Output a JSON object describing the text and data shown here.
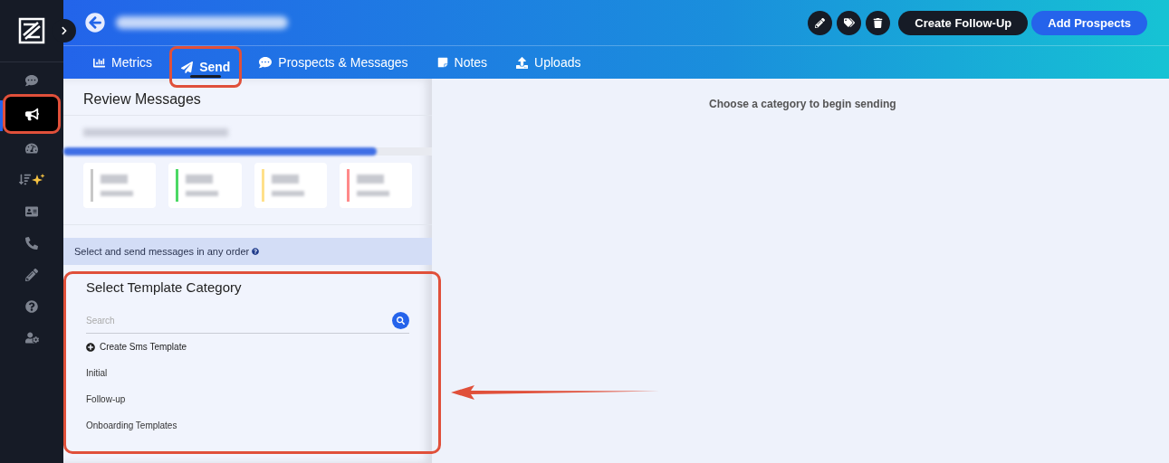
{
  "sidebar": {
    "items": [
      {
        "kind": "chat",
        "selected": false,
        "highlighted": false
      },
      {
        "kind": "megaphone",
        "selected": true,
        "highlighted": true
      },
      {
        "kind": "gauge",
        "selected": false,
        "highlighted": false
      },
      {
        "kind": "sort",
        "selected": false,
        "highlighted": false
      },
      {
        "kind": "contact",
        "selected": false,
        "highlighted": false
      },
      {
        "kind": "phone",
        "selected": false,
        "highlighted": false
      },
      {
        "kind": "pencil",
        "selected": false,
        "highlighted": false
      },
      {
        "kind": "help",
        "selected": false,
        "highlighted": false
      },
      {
        "kind": "user-settings",
        "selected": false,
        "highlighted": false
      }
    ]
  },
  "header": {
    "actions": [
      {
        "kind": "edit"
      },
      {
        "kind": "tags"
      },
      {
        "kind": "delete"
      }
    ],
    "buttons": [
      {
        "label": "Create Follow-Up",
        "kind": "dark"
      },
      {
        "label": "Add Prospects",
        "kind": "primary"
      }
    ]
  },
  "tabs": [
    {
      "label": "Metrics",
      "kind": "chart",
      "selected": false,
      "highlighted": false
    },
    {
      "label": "Send",
      "kind": "send",
      "selected": true,
      "highlighted": true
    },
    {
      "label": "Prospects & Messages",
      "kind": "chat",
      "selected": false,
      "highlighted": false
    },
    {
      "label": "Notes",
      "kind": "note",
      "selected": false,
      "highlighted": false
    },
    {
      "label": "Uploads",
      "kind": "upload",
      "selected": false,
      "highlighted": false
    }
  ],
  "review": {
    "title": "Review Messages",
    "progress": {
      "level": 0.85
    },
    "stats": [
      {
        "color": "#c8c8c8"
      },
      {
        "color": "#4cd964"
      },
      {
        "color": "#ffe08a"
      },
      {
        "color": "#ff8a8a"
      }
    ]
  },
  "notice": "Select and send messages in any order",
  "template_panel": {
    "title": "Select Template Category",
    "highlighted": true,
    "search": {
      "placeholder": "Search"
    },
    "create_label": "Create Sms Template",
    "categories": [
      "Initial",
      "Follow-up",
      "Onboarding Templates"
    ]
  },
  "main": {
    "hint": "Choose a category to begin sending",
    "pointer_arrow": true
  }
}
